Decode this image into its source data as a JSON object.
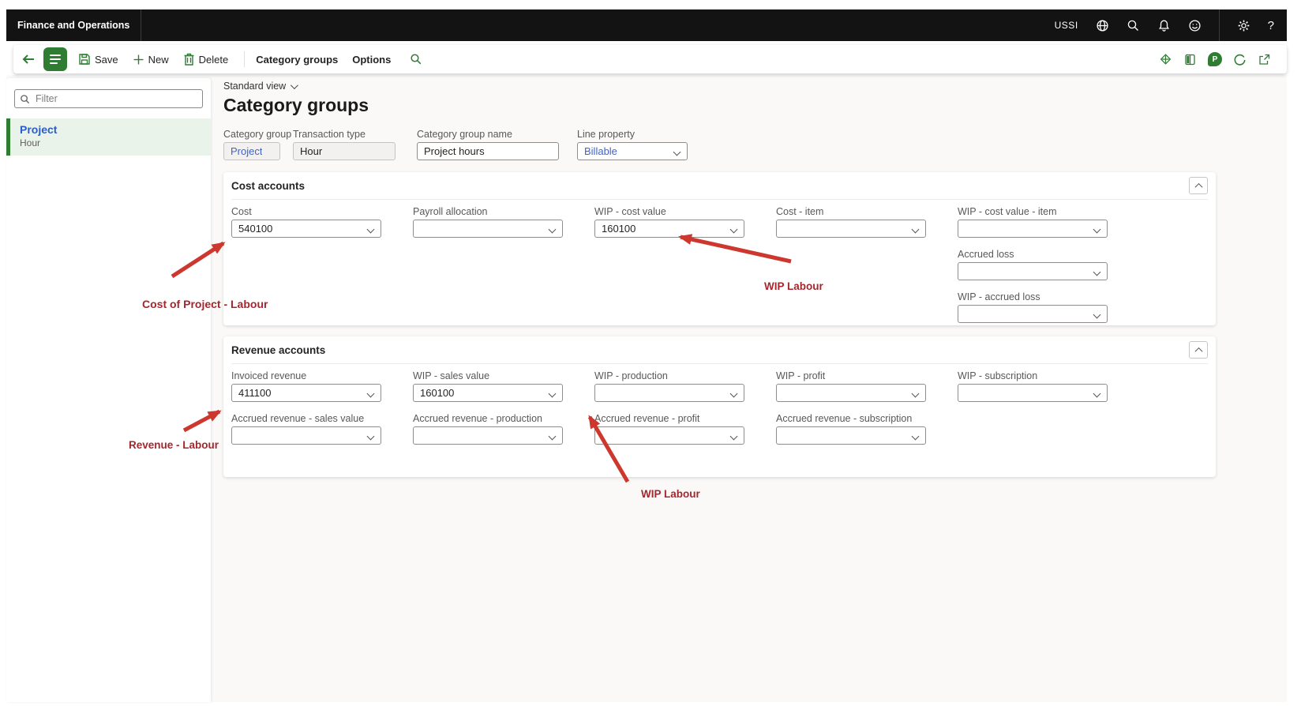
{
  "topbar": {
    "app_title": "Finance and Operations",
    "company": "USSI",
    "help_label": "?",
    "icons": [
      "globe-icon",
      "search-icon",
      "bell-icon",
      "smiley-icon",
      "gear-icon",
      "help-icon"
    ]
  },
  "toolbar": {
    "save_label": "Save",
    "new_label": "New",
    "delete_label": "Delete",
    "active_tab": "Category groups",
    "options_label": "Options",
    "chat_badge_letter": "P",
    "right_icons": [
      "diamond-icon",
      "book-icon",
      "chat-badge-icon",
      "refresh-icon",
      "open-in-new-window-icon"
    ]
  },
  "sidebar": {
    "filter_placeholder": "Filter",
    "items": [
      {
        "title": "Project",
        "subtitle": "Hour",
        "selected": true
      }
    ]
  },
  "page": {
    "view_selector": "Standard view",
    "title": "Category groups"
  },
  "header_fields": [
    {
      "label": "Category group",
      "value": "Project"
    },
    {
      "label": "Transaction type",
      "value": "Hour"
    },
    {
      "label": "Category group name",
      "value": "Project hours"
    },
    {
      "label": "Line property",
      "value": "Billable"
    }
  ],
  "sections": [
    {
      "title": "Cost accounts",
      "fields": [
        {
          "label": "Cost",
          "value": "540100"
        },
        {
          "label": "Payroll allocation",
          "value": ""
        },
        {
          "label": "WIP - cost value",
          "value": "160100"
        },
        {
          "label": "Cost - item",
          "value": ""
        },
        {
          "label": "WIP - cost value - item",
          "value": ""
        },
        {
          "label": "Accrued loss",
          "value": ""
        },
        {
          "label": "WIP - accrued loss",
          "value": ""
        }
      ]
    },
    {
      "title": "Revenue accounts",
      "fields": [
        {
          "label": "Invoiced revenue",
          "value": "411100"
        },
        {
          "label": "WIP - sales value",
          "value": "160100"
        },
        {
          "label": "WIP - production",
          "value": ""
        },
        {
          "label": "WIP - profit",
          "value": ""
        },
        {
          "label": "WIP - subscription",
          "value": ""
        },
        {
          "label": "Accrued revenue - sales value",
          "value": ""
        },
        {
          "label": "Accrued revenue - production",
          "value": ""
        },
        {
          "label": "Accrued revenue - profit",
          "value": ""
        },
        {
          "label": "Accrued revenue - subscription",
          "value": ""
        }
      ]
    }
  ],
  "annotations": [
    {
      "text": "Cost of Project - Labour"
    },
    {
      "text": "WIP Labour"
    },
    {
      "text": "Revenue - Labour"
    },
    {
      "text": "WIP Labour"
    }
  ],
  "colors": {
    "accent_green": "#2e7d32",
    "selected_row_bg": "#e9f3e9",
    "link_blue": "#3f63c8",
    "annotation_red": "#cd372e",
    "annotation_text_red": "#a3272d",
    "topbar_bg": "#131313"
  }
}
